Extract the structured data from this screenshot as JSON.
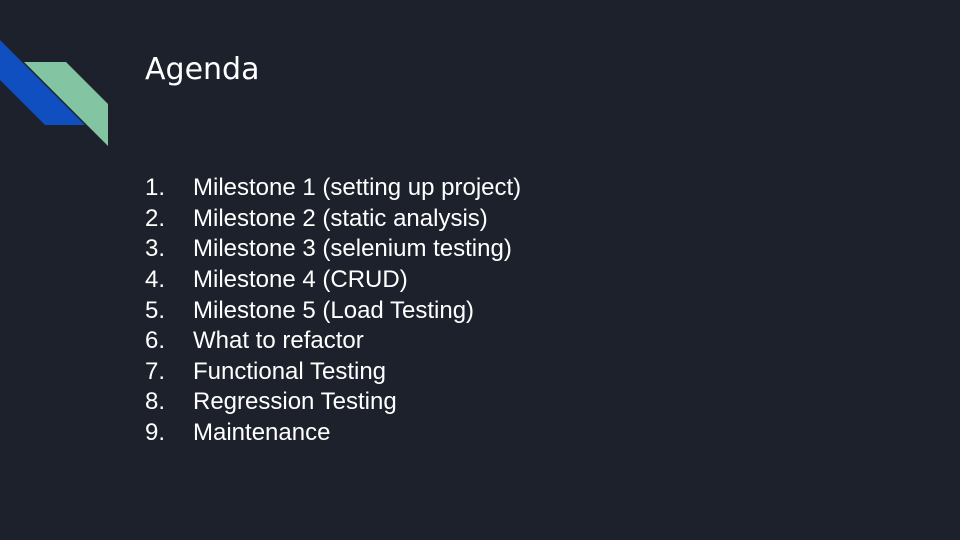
{
  "slide": {
    "title": "Agenda",
    "items": [
      {
        "number": "1.",
        "text": "Milestone 1 (setting up project)"
      },
      {
        "number": "2.",
        "text": "Milestone 2 (static analysis)"
      },
      {
        "number": "3.",
        "text": "Milestone 3 (selenium testing)"
      },
      {
        "number": "4.",
        "text": "Milestone 4 (CRUD)"
      },
      {
        "number": "5.",
        "text": "Milestone 5 (Load Testing)"
      },
      {
        "number": "6.",
        "text": "What to refactor"
      },
      {
        "number": "7.",
        "text": "Functional Testing"
      },
      {
        "number": "8.",
        "text": "Regression Testing"
      },
      {
        "number": "9.",
        "text": "Maintenance"
      }
    ]
  },
  "colors": {
    "background": "#1c212c",
    "text": "#ffffff",
    "accent_blue": "#0f4fc0",
    "accent_green": "#83c5a2"
  },
  "icons": [
    "corner-stripe-decoration"
  ]
}
